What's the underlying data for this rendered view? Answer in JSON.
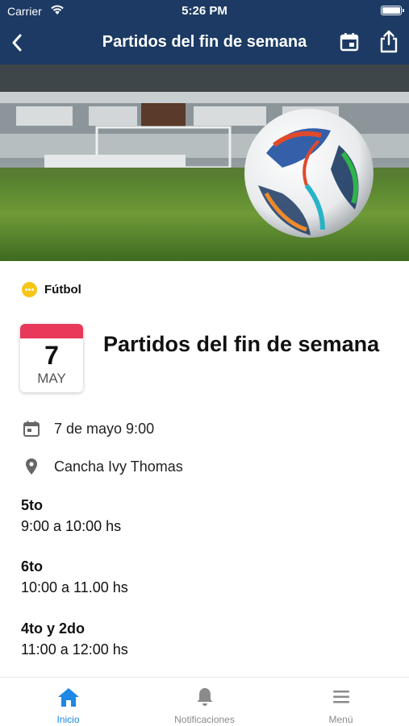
{
  "status_bar": {
    "carrier": "Carrier",
    "time": "5:26 PM"
  },
  "nav": {
    "title": "Partidos del fin de semana"
  },
  "event": {
    "category": "Fútbol",
    "date_day": "7",
    "date_month": "MAY",
    "title": "Partidos del fin de semana",
    "datetime": "7 de mayo 9:00",
    "location": "Cancha Ivy Thomas",
    "schedule": [
      {
        "group": "5to",
        "time": "9:00 a 10:00 hs"
      },
      {
        "group": "6to",
        "time": "10:00 a 11.00 hs"
      },
      {
        "group": "4to y 2do",
        "time": "11:00 a 12:00 hs"
      }
    ]
  },
  "tabs": [
    {
      "label": "Inicio",
      "icon": "home-icon",
      "active": true
    },
    {
      "label": "Notificaciones",
      "icon": "bell-icon",
      "active": false
    },
    {
      "label": "Menú",
      "icon": "menu-icon",
      "active": false
    }
  ],
  "colors": {
    "header": "#1c3a63",
    "accent": "#1e88e5",
    "date_top": "#e8395a",
    "category": "#f5c518"
  }
}
